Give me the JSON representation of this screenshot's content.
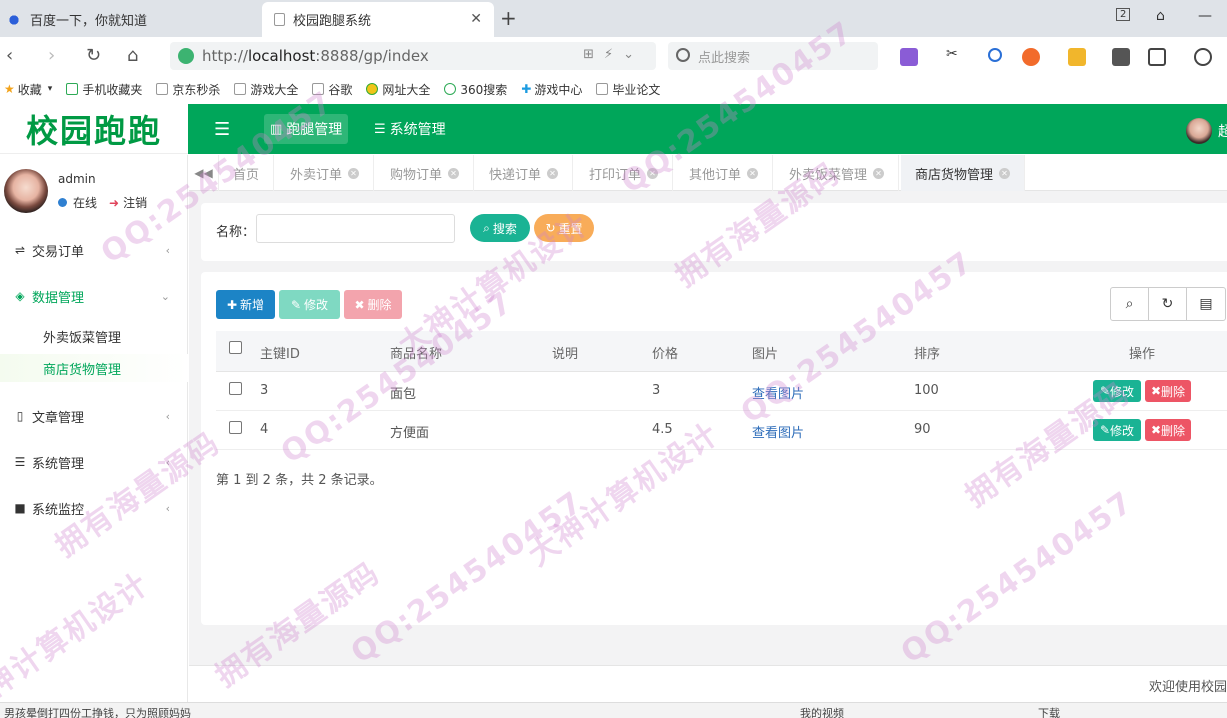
{
  "browser": {
    "tabs": [
      {
        "title": "百度一下，你就知道"
      },
      {
        "title": "校园跑腿系统"
      }
    ],
    "new_tab_icon": "plus-icon",
    "url_prefix": "http://",
    "url_host": "localhost",
    "url_rest": ":8888/gp/index",
    "search_placeholder": "点此搜索",
    "bookmarks": [
      "收藏",
      "手机收藏夹",
      "京东秒杀",
      "游戏大全",
      "谷歌",
      "网址大全",
      "360搜索",
      "游戏中心",
      "毕业论文"
    ]
  },
  "app": {
    "logo": "校园跑跑",
    "topnav": [
      {
        "label": "跑腿管理"
      },
      {
        "label": "系统管理"
      }
    ],
    "user_top": "超"
  },
  "sidebar": {
    "user": "admin",
    "status": "在线",
    "logout": "注销",
    "menus": [
      {
        "label": "交易订单"
      },
      {
        "label": "数据管理"
      },
      {
        "label": "文章管理"
      },
      {
        "label": "系统管理"
      },
      {
        "label": "系统监控"
      }
    ],
    "submenus": [
      {
        "label": "外卖饭菜管理"
      },
      {
        "label": "商店货物管理"
      }
    ]
  },
  "tabs": [
    {
      "label": "首页"
    },
    {
      "label": "外卖订单"
    },
    {
      "label": "购物订单"
    },
    {
      "label": "快递订单"
    },
    {
      "label": "打印订单"
    },
    {
      "label": "其他订单"
    },
    {
      "label": "外卖饭菜管理"
    },
    {
      "label": "商店货物管理"
    }
  ],
  "search": {
    "label": "名称：",
    "value": "",
    "search_btn": "搜索",
    "reset_btn": "重置"
  },
  "toolbar": {
    "add": "新增",
    "edit": "修改",
    "delete": "删除"
  },
  "table": {
    "columns": [
      "主键ID",
      "商品名称",
      "说明",
      "价格",
      "图片",
      "排序",
      "操作"
    ],
    "rows": [
      {
        "id": "3",
        "name": "面包",
        "desc": "",
        "price": "3",
        "image": "查看图片",
        "sort": "100"
      },
      {
        "id": "4",
        "name": "方便面",
        "desc": "",
        "price": "4.5",
        "image": "查看图片",
        "sort": "90"
      }
    ],
    "row_edit": "修改",
    "row_delete": "删除",
    "pager": "第 1 到 2 条，共 2 条记录。"
  },
  "footer": "欢迎使用校园",
  "statusbar": {
    "left": "男孩晕倒打四份工挣钱，只为照顾妈妈",
    "video": "我的视频",
    "download": "下载"
  },
  "watermarks": [
    "QQ:254540457",
    "拥有海量源码",
    "大神计算机设计"
  ]
}
